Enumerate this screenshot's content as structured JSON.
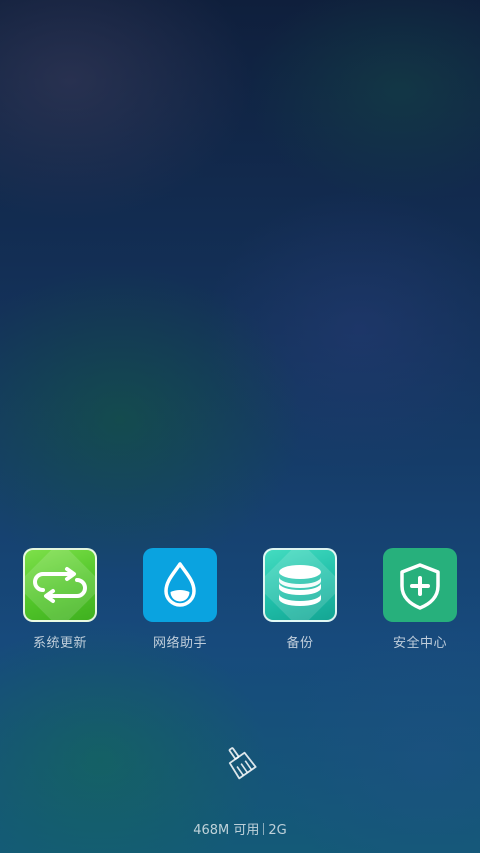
{
  "apps": [
    {
      "label": "系统更新",
      "icon": "sync-icon"
    },
    {
      "label": "网络助手",
      "icon": "water-drop-icon"
    },
    {
      "label": "备份",
      "icon": "database-stack-icon"
    },
    {
      "label": "安全中心",
      "icon": "shield-plus-icon"
    }
  ],
  "cleaner": {
    "icon": "broom-icon"
  },
  "status": {
    "memory": "468M 可用",
    "total": "2G"
  },
  "colors": {
    "update_green": "#52c62a",
    "network_blue": "#0aa3e0",
    "backup_teal": "#20bfa9",
    "security_green": "#27b07c"
  }
}
